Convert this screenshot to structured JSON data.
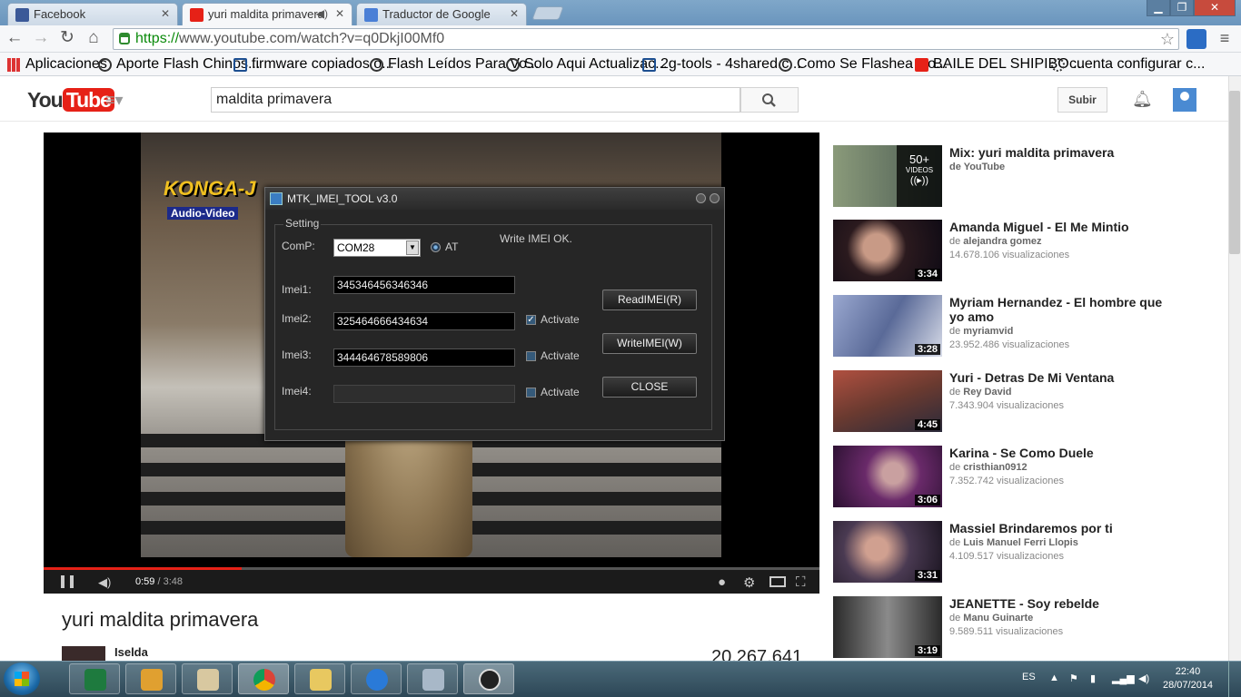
{
  "browser": {
    "tabs": [
      {
        "label": "Facebook",
        "favicon_color": "#3b5998"
      },
      {
        "label": "yuri maldita primavera",
        "favicon_color": "#e62117"
      },
      {
        "label": "Traductor de Google",
        "favicon_color": "#4a7fd6"
      }
    ],
    "url_scheme": "https://",
    "url_rest": "www.youtube.com/watch?v=q0DkjI00Mf0",
    "bookmarks": [
      "Aplicaciones",
      "Aporte Flash Chinos...",
      "firmware copiados o...",
      "Flash Leídos Para Vo...",
      "Solo Aqui Actualizac...",
      "2g-tools - 4shared.c...",
      "Como Se Flashea Co...",
      "BAILE DEL SHIPIBO ...",
      "cuenta configurar c..."
    ]
  },
  "youtube": {
    "logo_you": "You",
    "logo_tube": "Tube",
    "search_value": "maldita primavera",
    "upload_label": "Subir",
    "brand_color": "#e62117"
  },
  "player": {
    "overlay_logo": "KONGA-J",
    "overlay_sub": "Audio-Video",
    "time_current": "0:59",
    "time_total": " / 3:48",
    "progress_fraction": 0.255
  },
  "dialog": {
    "title": "MTK_IMEI_TOOL v3.0",
    "group_label": "Setting",
    "com_label": "ComP:",
    "com_value": "COM28",
    "at_label": "AT",
    "status": "Write IMEI OK.",
    "imei1_label": "Imei1:",
    "imei1_value": "345346456346346",
    "imei2_label": "Imei2:",
    "imei2_value": "325464666434634",
    "imei3_label": "Imei3:",
    "imei3_value": "344464678589806",
    "imei4_label": "Imei4:",
    "imei4_value": "",
    "activate_label": "Activate",
    "read_label": "ReadIMEI(R)",
    "write_label": "WriteIMEI(W)",
    "close_label": "CLOSE"
  },
  "video_info": {
    "title": "yuri maldita primavera",
    "channel": "Iselda",
    "views": "20.267.641"
  },
  "sidebar": {
    "items": [
      {
        "title": "Mix: yuri maldita primavera",
        "by_prefix": "",
        "by": "de YouTube",
        "views": "",
        "duration": "",
        "mix_count": "50+",
        "mix_label": "VIDEOS",
        "thumb": "#5a6a72"
      },
      {
        "title": "Amanda Miguel - El Me Mintio",
        "by_prefix": "de ",
        "by": "alejandra gomez",
        "views": "14.678.106 visualizaciones",
        "duration": "3:34",
        "thumb": "#2b1a1e"
      },
      {
        "title": "Myriam Hernandez - El hombre que yo amo",
        "by_prefix": "de ",
        "by": "myriamvid",
        "views": "23.952.486 visualizaciones",
        "duration": "3:28",
        "thumb": "#6f7fa8"
      },
      {
        "title": "Yuri - Detras De Mi Ventana",
        "by_prefix": "de ",
        "by": "Rey David",
        "views": "7.343.904 visualizaciones",
        "duration": "4:45",
        "thumb": "#7a3e34"
      },
      {
        "title": "Karina - Se Como Duele",
        "by_prefix": "de ",
        "by": "cristhian0912",
        "views": "7.352.742 visualizaciones",
        "duration": "3:06",
        "thumb": "#6a2a6a"
      },
      {
        "title": "Massiel Brindaremos por ti",
        "by_prefix": "de ",
        "by": "Luis Manuel Ferri Llopis",
        "views": "4.109.517 visualizaciones",
        "duration": "3:31",
        "thumb": "#4a3a52"
      },
      {
        "title": "JEANETTE - Soy rebelde",
        "by_prefix": "de ",
        "by": "Manu Guinarte",
        "views": "9.589.511 visualizaciones",
        "duration": "3:19",
        "thumb": "#3a3a3a"
      }
    ]
  },
  "taskbar": {
    "lang": "ES",
    "time": "22:40",
    "date": "28/07/2014"
  }
}
